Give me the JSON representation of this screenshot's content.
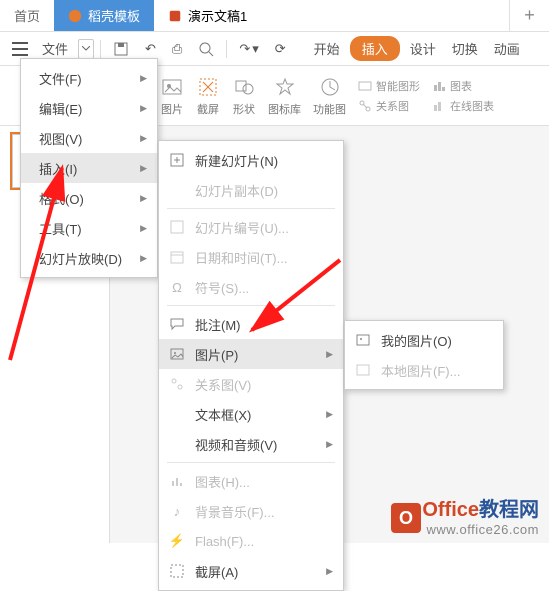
{
  "tabs": {
    "home": "首页",
    "template": "稻壳模板",
    "doc": "演示文稿1",
    "plus": "+"
  },
  "toolbar": {
    "file": "文件",
    "undo_glyph": "↶",
    "redo_glyph": "↷",
    "print_glyph": "⎙",
    "preview_glyph": "👁",
    "start": "开始",
    "insert": "插入",
    "design": "设计",
    "transition": "切换",
    "anim": "动画"
  },
  "ribbon": {
    "picture": "图片",
    "screenshot": "截屏",
    "shape": "形状",
    "iconlib": "图标库",
    "funcimg": "功能图",
    "smartart": "智能图形",
    "chart": "图表",
    "relation": "关系图",
    "onlinechart": "在线图表"
  },
  "menu1": {
    "file": "文件(F)",
    "edit": "编辑(E)",
    "view": "视图(V)",
    "insert": "插入(I)",
    "format": "格式(O)",
    "tools": "工具(T)",
    "slideshow": "幻灯片放映(D)"
  },
  "menu2": {
    "new_slide": "新建幻灯片(N)",
    "dup_slide": "幻灯片副本(D)",
    "slide_number": "幻灯片编号(U)...",
    "date_time": "日期和时间(T)...",
    "symbol": "符号(S)...",
    "comment": "批注(M)",
    "picture": "图片(P)",
    "relation": "关系图(V)",
    "textbox": "文本框(X)",
    "media": "视频和音频(V)",
    "chart": "图表(H)...",
    "bgmusic": "背景音乐(F)...",
    "flash": "Flash(F)...",
    "screenshot": "截屏(A)"
  },
  "menu3": {
    "my_pictures": "我的图片(O)",
    "local_picture": "本地图片(F)..."
  },
  "watermark": {
    "brand_o": "Office",
    "brand_rest": "教程网",
    "url": "www.office26.com"
  }
}
